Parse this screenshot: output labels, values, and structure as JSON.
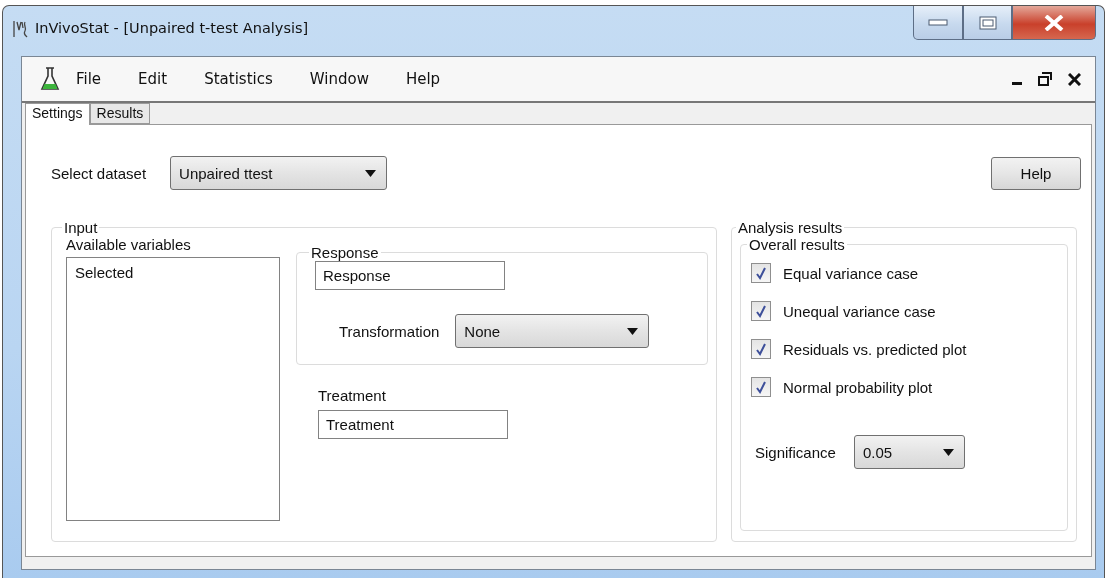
{
  "window": {
    "title": "InVivoStat - [Unpaired t-test Analysis]"
  },
  "menu": [
    "File",
    "Edit",
    "Statistics",
    "Window",
    "Help"
  ],
  "tabs": [
    {
      "label": "Settings",
      "selected": true
    },
    {
      "label": "Results",
      "selected": false
    }
  ],
  "dataset": {
    "label": "Select dataset",
    "value": "Unpaired ttest"
  },
  "help_button": "Help",
  "input": {
    "title": "Input",
    "available_label": "Available variables",
    "available": [
      "Selected"
    ],
    "response": {
      "title": "Response",
      "value": "Response",
      "transformation_label": "Transformation",
      "transformation": "None"
    },
    "treatment": {
      "label": "Treatment",
      "value": "Treatment"
    }
  },
  "analysis": {
    "title": "Analysis results",
    "overall_title": "Overall results",
    "options": [
      {
        "label": "Equal variance case",
        "checked": true
      },
      {
        "label": "Unequal variance case",
        "checked": true
      },
      {
        "label": "Residuals vs. predicted plot",
        "checked": true
      },
      {
        "label": "Normal probability plot",
        "checked": true
      }
    ],
    "significance_label": "Significance",
    "significance": "0.05"
  }
}
